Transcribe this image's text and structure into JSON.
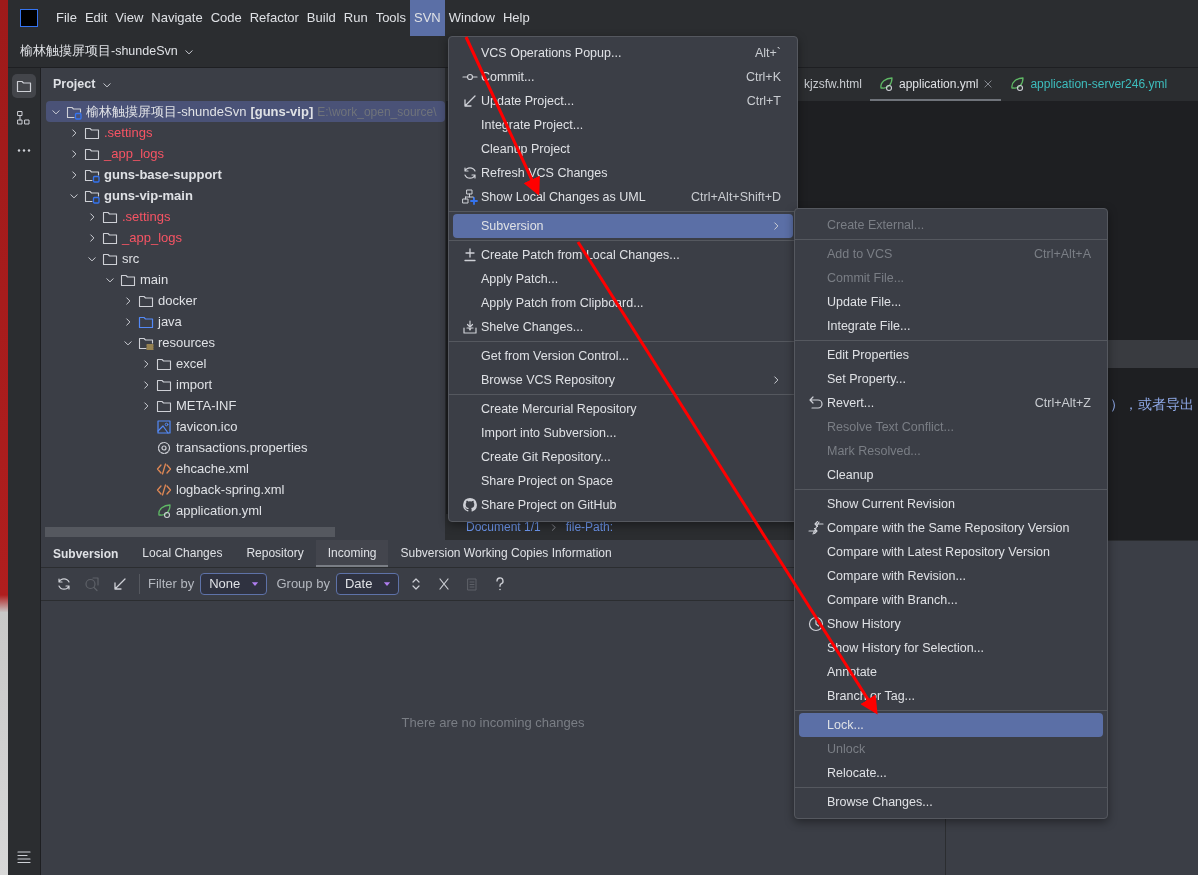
{
  "menu_bar": [
    {
      "label": "File",
      "selected": false
    },
    {
      "label": "Edit",
      "selected": false
    },
    {
      "label": "View",
      "selected": false
    },
    {
      "label": "Navigate",
      "selected": false
    },
    {
      "label": "Code",
      "selected": false
    },
    {
      "label": "Refactor",
      "selected": false
    },
    {
      "label": "Build",
      "selected": false
    },
    {
      "label": "Run",
      "selected": false
    },
    {
      "label": "Tools",
      "selected": false
    },
    {
      "label": "SVN",
      "selected": true
    },
    {
      "label": "Window",
      "selected": false
    },
    {
      "label": "Help",
      "selected": false
    }
  ],
  "project_selector": {
    "label": "榆林触摸屏项目-shundeSvn"
  },
  "project_panel": {
    "title": "Project",
    "tree": [
      {
        "label": "榆林触摸屏项目-shundeSvn",
        "module": "[guns-vip]",
        "path": "E:\\work_open_source\\",
        "kind": "project",
        "expanded": true,
        "selected": true,
        "ignored": false,
        "children": [
          {
            "label": ".settings",
            "kind": "folder",
            "expanded": false,
            "selected": false,
            "ignored": true
          },
          {
            "label": "_app_logs",
            "kind": "folder",
            "expanded": false,
            "selected": false,
            "ignored": true
          },
          {
            "label": "guns-base-support",
            "kind": "module",
            "expanded": false,
            "selected": false,
            "ignored": false
          },
          {
            "label": "guns-vip-main",
            "kind": "module",
            "expanded": true,
            "selected": false,
            "ignored": false,
            "children": [
              {
                "label": ".settings",
                "kind": "folder",
                "expanded": false,
                "selected": false,
                "ignored": true
              },
              {
                "label": "_app_logs",
                "kind": "folder",
                "expanded": false,
                "selected": false,
                "ignored": true
              },
              {
                "label": "src",
                "kind": "folder",
                "expanded": true,
                "selected": false,
                "ignored": false,
                "children": [
                  {
                    "label": "main",
                    "kind": "folder",
                    "expanded": true,
                    "selected": false,
                    "ignored": false,
                    "children": [
                      {
                        "label": "docker",
                        "kind": "folder",
                        "expanded": false,
                        "selected": false,
                        "ignored": false
                      },
                      {
                        "label": "java",
                        "kind": "source",
                        "expanded": false,
                        "selected": false,
                        "ignored": false
                      },
                      {
                        "label": "resources",
                        "kind": "resources",
                        "expanded": true,
                        "selected": false,
                        "ignored": false,
                        "children": [
                          {
                            "label": "excel",
                            "kind": "folder",
                            "expanded": false,
                            "selected": false,
                            "ignored": false
                          },
                          {
                            "label": "import",
                            "kind": "folder",
                            "expanded": false,
                            "selected": false,
                            "ignored": false
                          },
                          {
                            "label": "META-INF",
                            "kind": "folder",
                            "expanded": false,
                            "selected": false,
                            "ignored": false
                          },
                          {
                            "label": "favicon.ico",
                            "kind": "image",
                            "selected": false,
                            "ignored": false
                          },
                          {
                            "label": "transactions.properties",
                            "kind": "properties",
                            "selected": false,
                            "ignored": false
                          },
                          {
                            "label": "ehcache.xml",
                            "kind": "xml",
                            "selected": false,
                            "ignored": false
                          },
                          {
                            "label": "logback-spring.xml",
                            "kind": "xml",
                            "selected": false,
                            "ignored": false
                          },
                          {
                            "label": "application.yml",
                            "kind": "yml",
                            "selected": false,
                            "ignored": false
                          }
                        ]
                      }
                    ]
                  }
                ]
              }
            ]
          }
        ]
      }
    ]
  },
  "editor": {
    "tabs": [
      {
        "label": "kjzsfw.html",
        "kind": "html",
        "selected": false,
        "modified": false
      },
      {
        "label": "application.yml",
        "kind": "yml",
        "selected": true,
        "modified": false
      },
      {
        "label": "application-server246.yml",
        "kind": "yml",
        "selected": false,
        "modified": true
      }
    ],
    "code_text": "），或者导出",
    "breadcrumb": [
      "Document 1/1",
      "file-Path:"
    ]
  },
  "svn_menu": [
    [
      {
        "label": "VCS Operations Popup...",
        "shortcut": "Alt+`",
        "kind": "plain",
        "submenu": false,
        "selected": false
      },
      {
        "label": "Commit...",
        "shortcut": "Ctrl+K",
        "kind": "commit",
        "submenu": false,
        "selected": false
      },
      {
        "label": "Update Project...",
        "shortcut": "Ctrl+T",
        "kind": "update",
        "submenu": false,
        "selected": false
      },
      {
        "label": "Integrate Project...",
        "kind": "plain",
        "submenu": false,
        "selected": false
      },
      {
        "label": "Cleanup Project",
        "kind": "plain",
        "submenu": false,
        "selected": false
      },
      {
        "label": "Refresh VCS Changes",
        "kind": "refresh",
        "submenu": false,
        "selected": false
      },
      {
        "label": "Show Local Changes as UML",
        "shortcut": "Ctrl+Alt+Shift+D",
        "kind": "uml",
        "submenu": false,
        "selected": false
      }
    ],
    [
      {
        "label": "Subversion",
        "kind": "plain",
        "submenu": true,
        "selected": true
      }
    ],
    [
      {
        "label": "Create Patch from Local Changes...",
        "kind": "patch",
        "submenu": false,
        "selected": false
      },
      {
        "label": "Apply Patch...",
        "kind": "plain",
        "submenu": false,
        "selected": false
      },
      {
        "label": "Apply Patch from Clipboard...",
        "kind": "plain",
        "submenu": false,
        "selected": false
      },
      {
        "label": "Shelve Changes...",
        "kind": "shelve",
        "submenu": false,
        "selected": false
      }
    ],
    [
      {
        "label": "Get from Version Control...",
        "kind": "plain",
        "submenu": false,
        "selected": false
      },
      {
        "label": "Browse VCS Repository",
        "kind": "plain",
        "submenu": true,
        "selected": false
      }
    ],
    [
      {
        "label": "Create Mercurial Repository",
        "kind": "plain",
        "submenu": false,
        "selected": false
      },
      {
        "label": "Import into Subversion...",
        "kind": "plain",
        "submenu": false,
        "selected": false
      },
      {
        "label": "Create Git Repository...",
        "kind": "plain",
        "submenu": false,
        "selected": false
      },
      {
        "label": "Share Project on Space",
        "kind": "plain",
        "submenu": false,
        "selected": false
      },
      {
        "label": "Share Project on GitHub",
        "kind": "github",
        "submenu": false,
        "selected": false
      }
    ]
  ],
  "subversion_submenu": [
    [
      {
        "label": "Create External...",
        "kind": "plain",
        "disabled": true,
        "selected": false
      }
    ],
    [
      {
        "label": "Add to VCS",
        "shortcut": "Ctrl+Alt+A",
        "kind": "plain",
        "disabled": true,
        "selected": false
      },
      {
        "label": "Commit File...",
        "kind": "plain",
        "disabled": true,
        "selected": false
      },
      {
        "label": "Update File...",
        "kind": "plain",
        "disabled": false,
        "selected": false
      },
      {
        "label": "Integrate File...",
        "kind": "plain",
        "disabled": false,
        "selected": false
      }
    ],
    [
      {
        "label": "Edit Properties",
        "kind": "plain",
        "disabled": false,
        "selected": false
      },
      {
        "label": "Set Property...",
        "kind": "plain",
        "disabled": false,
        "selected": false
      },
      {
        "label": "Revert...",
        "shortcut": "Ctrl+Alt+Z",
        "kind": "revert",
        "disabled": false,
        "selected": false
      },
      {
        "label": "Resolve Text Conflict...",
        "kind": "plain",
        "disabled": true,
        "selected": false
      },
      {
        "label": "Mark Resolved...",
        "kind": "plain",
        "disabled": true,
        "selected": false
      },
      {
        "label": "Cleanup",
        "kind": "plain",
        "disabled": false,
        "selected": false
      }
    ],
    [
      {
        "label": "Show Current Revision",
        "kind": "plain",
        "disabled": false,
        "selected": false
      },
      {
        "label": "Compare with the Same Repository Version",
        "kind": "compare",
        "disabled": false,
        "selected": false
      },
      {
        "label": "Compare with Latest Repository Version",
        "kind": "plain",
        "disabled": false,
        "selected": false
      },
      {
        "label": "Compare with Revision...",
        "kind": "plain",
        "disabled": false,
        "selected": false
      },
      {
        "label": "Compare with Branch...",
        "kind": "plain",
        "disabled": false,
        "selected": false
      },
      {
        "label": "Show History",
        "kind": "history",
        "disabled": false,
        "selected": false
      },
      {
        "label": "Show History for Selection...",
        "kind": "plain",
        "disabled": false,
        "selected": false
      },
      {
        "label": "Annotate",
        "kind": "plain",
        "disabled": false,
        "selected": false
      },
      {
        "label": "Branch or Tag...",
        "kind": "plain",
        "disabled": false,
        "selected": false
      }
    ],
    [
      {
        "label": "Lock...",
        "kind": "plain",
        "disabled": false,
        "selected": true
      },
      {
        "label": "Unlock",
        "kind": "plain",
        "disabled": true,
        "selected": false
      },
      {
        "label": "Relocate...",
        "kind": "plain",
        "disabled": false,
        "selected": false
      }
    ],
    [
      {
        "label": "Browse Changes...",
        "kind": "plain",
        "disabled": false,
        "selected": false
      }
    ]
  ],
  "bottom_panel": {
    "title": "Subversion",
    "tabs": [
      {
        "label": "Local Changes",
        "selected": false
      },
      {
        "label": "Repository",
        "selected": false
      },
      {
        "label": "Incoming",
        "selected": true
      },
      {
        "label": "Subversion Working Copies Information",
        "selected": false
      }
    ],
    "filter_label": "Filter by",
    "filter_value": "None",
    "group_label": "Group by",
    "group_value": "Date",
    "empty_text": "There are no incoming changes"
  }
}
